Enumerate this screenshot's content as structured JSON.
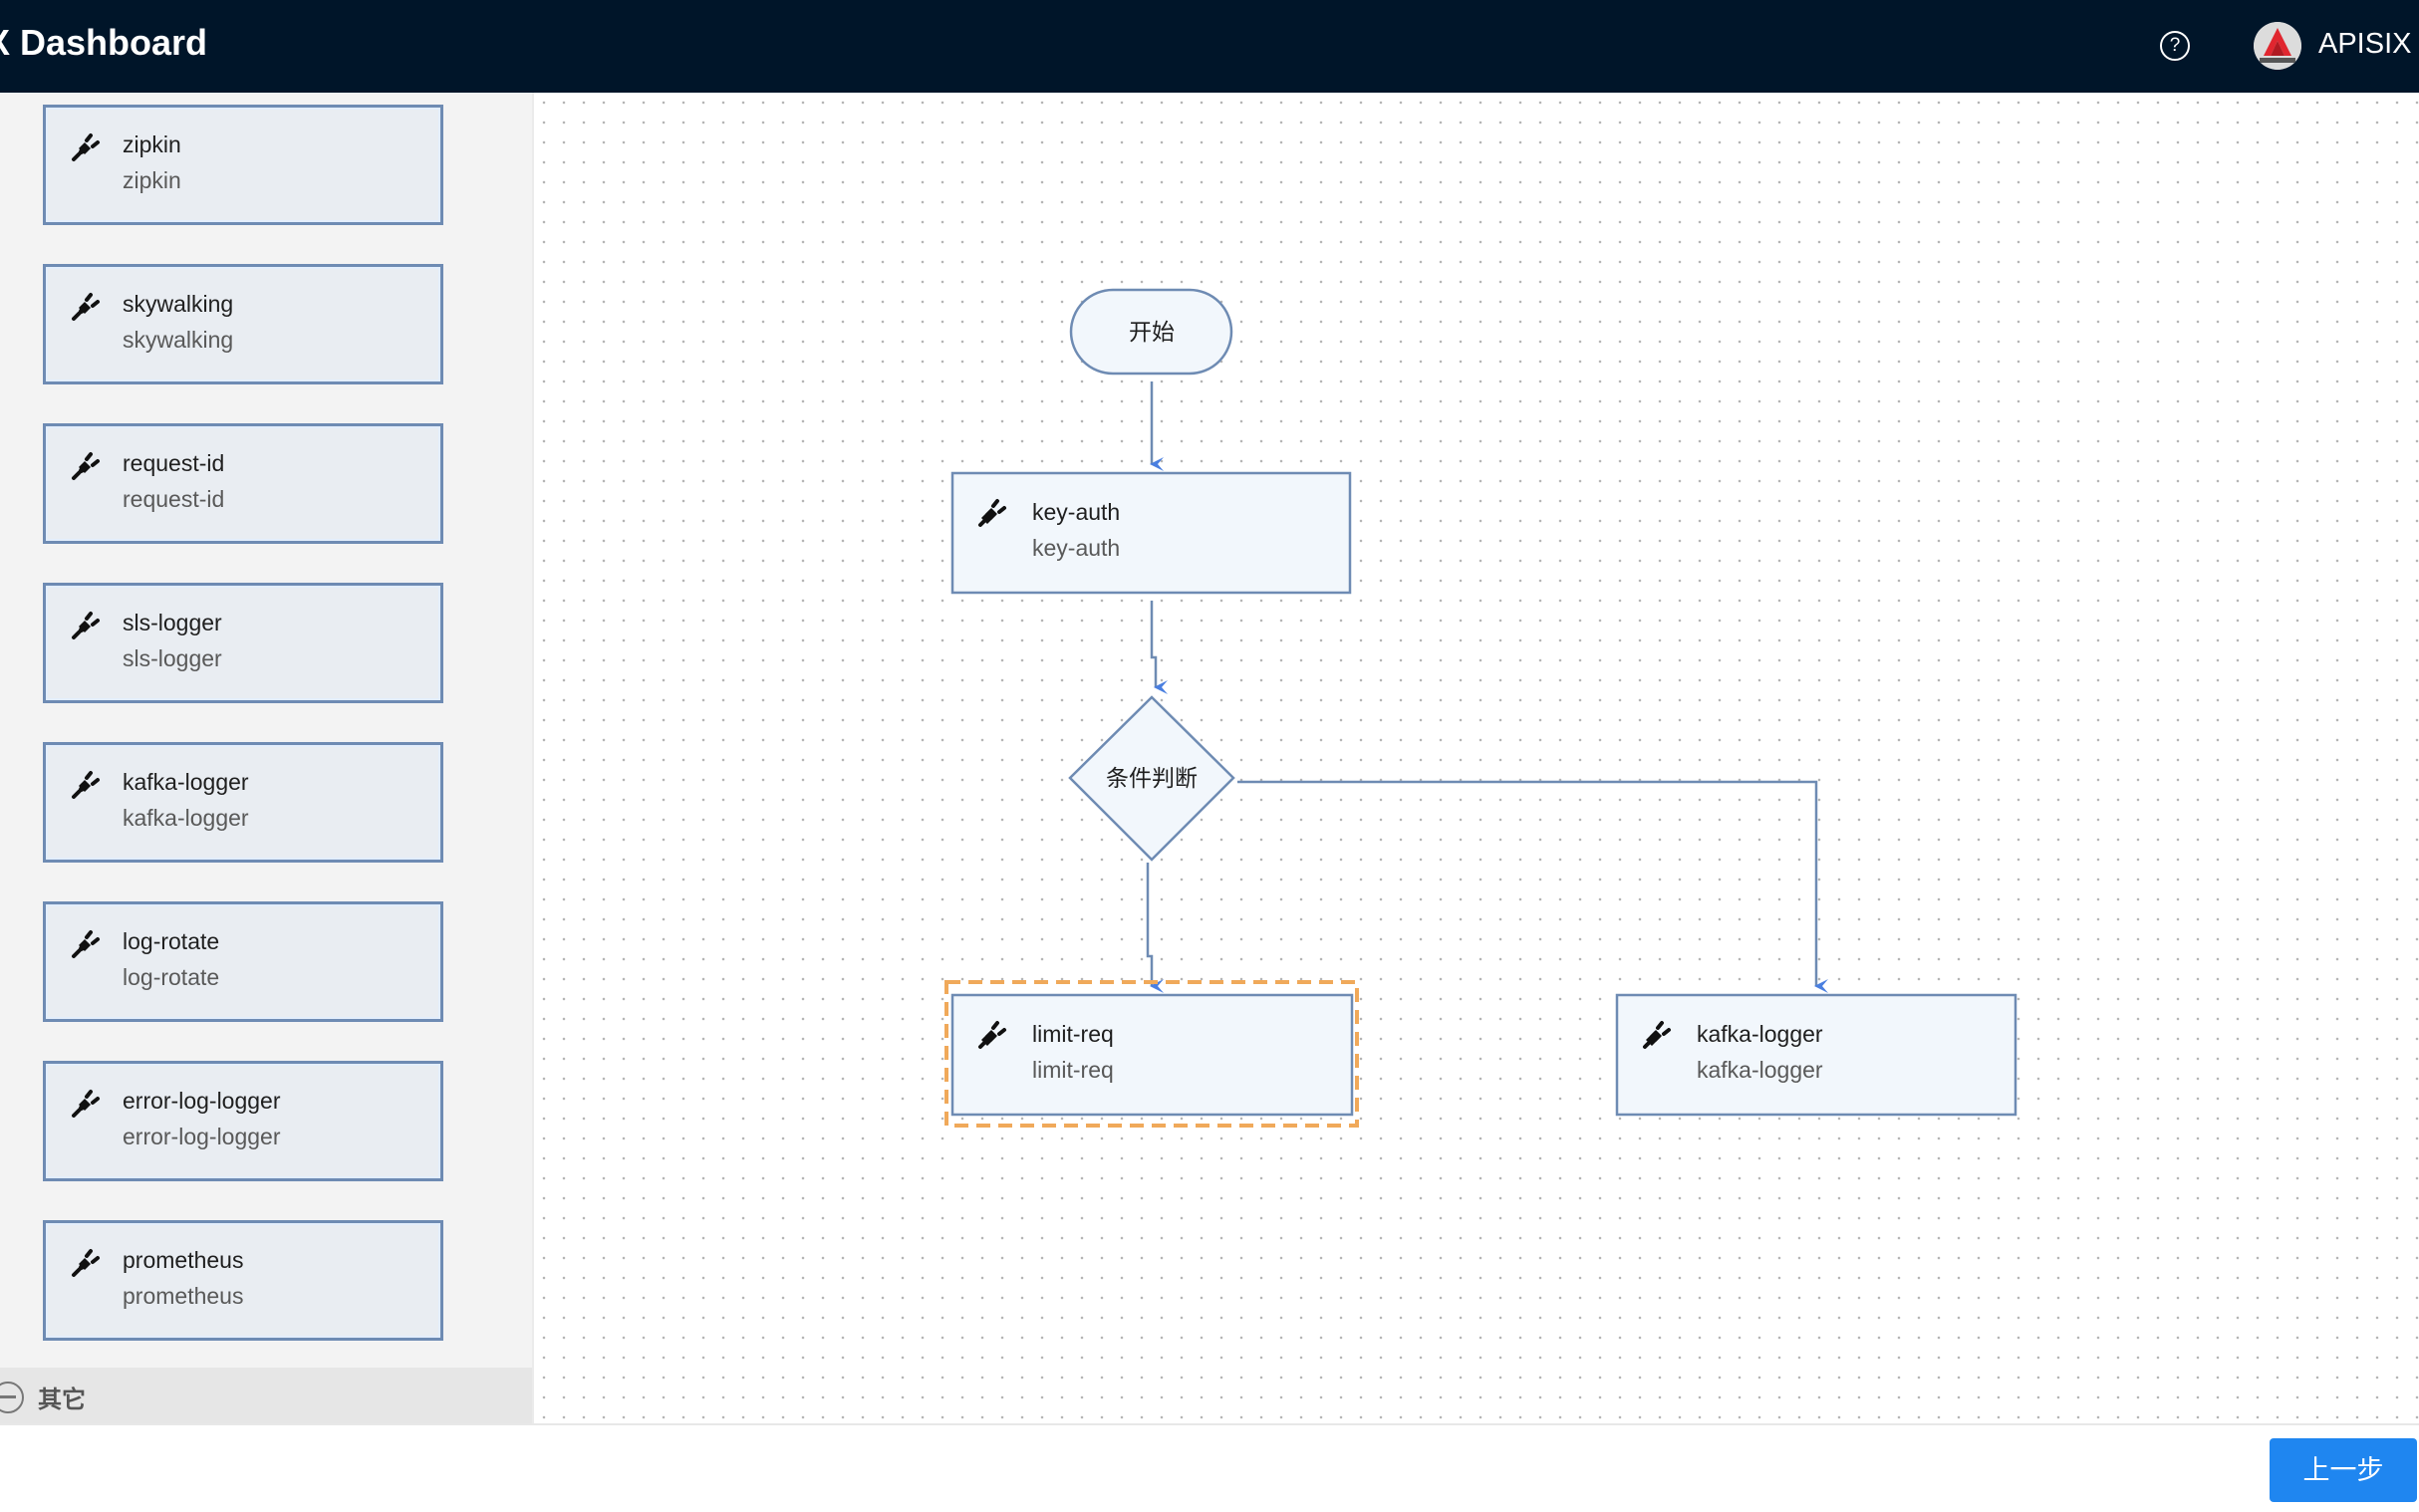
{
  "header": {
    "title": "X Dashboard",
    "help_icon": "question-circle-icon",
    "user_name": "APISIX U"
  },
  "sidebar": {
    "plugins": [
      {
        "name": "zipkin",
        "description": "zipkin"
      },
      {
        "name": "skywalking",
        "description": "skywalking"
      },
      {
        "name": "request-id",
        "description": "request-id"
      },
      {
        "name": "sls-logger",
        "description": "sls-logger"
      },
      {
        "name": "kafka-logger",
        "description": "kafka-logger"
      },
      {
        "name": "log-rotate",
        "description": "log-rotate"
      },
      {
        "name": "error-log-logger",
        "description": "error-log-logger"
      },
      {
        "name": "prometheus",
        "description": "prometheus"
      }
    ],
    "group": {
      "label": "其它",
      "icon": "minus-circle-icon"
    }
  },
  "flow": {
    "start_label": "开始",
    "nodes": {
      "key_auth": {
        "name": "key-auth",
        "description": "key-auth"
      },
      "condition": {
        "label": "条件判断"
      },
      "limit_req": {
        "name": "limit-req",
        "description": "limit-req",
        "selected": true
      },
      "kafka_logger": {
        "name": "kafka-logger",
        "description": "kafka-logger"
      }
    },
    "colors": {
      "node_border": "#6e8bb3",
      "node_fill": "#f2f7fc",
      "edge": "#6e8bb3",
      "arrow": "#4a7fe0",
      "selection": "#f0a95a"
    }
  },
  "footer": {
    "prev_label": "上一步"
  }
}
